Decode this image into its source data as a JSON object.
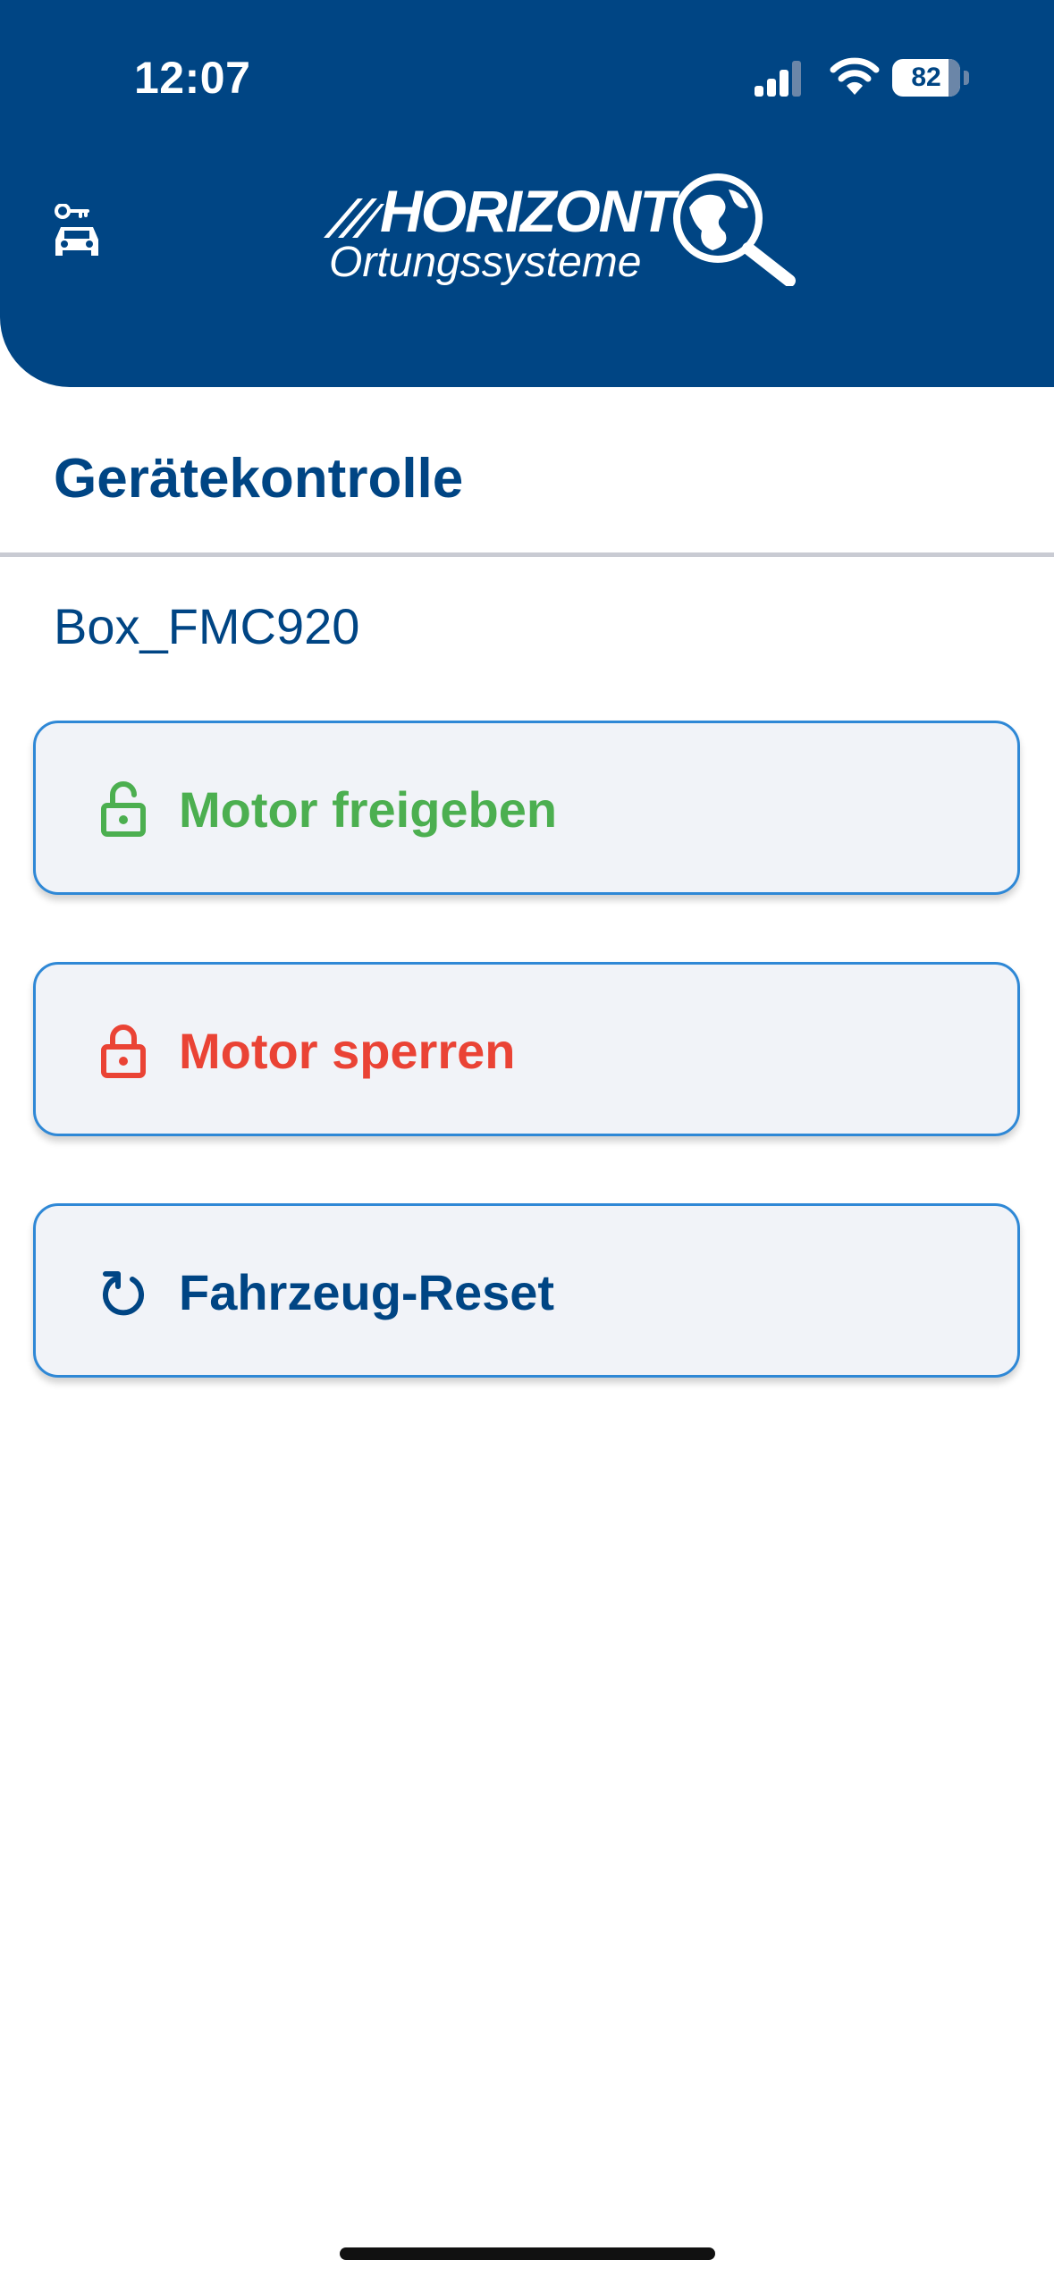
{
  "status_bar": {
    "time": "12:07",
    "battery": "82"
  },
  "header": {
    "logo_brand": "HORIZONT",
    "logo_sub": "Ortungssysteme",
    "left_icon": "car-key-icon"
  },
  "page": {
    "title": "Gerätekontrolle",
    "device_name": "Box_FMC920"
  },
  "actions": [
    {
      "label": "Motor freigeben",
      "icon": "unlock-icon",
      "color": "#4caf50"
    },
    {
      "label": "Motor sperren",
      "icon": "lock-icon",
      "color": "#ea4335"
    },
    {
      "label": "Fahrzeug-Reset",
      "icon": "reset-icon",
      "color": "#004584"
    }
  ],
  "colors": {
    "brand": "#004584",
    "button_border": "#2f88d6",
    "button_bg": "#f1f3f8",
    "divider": "#c9cbd3"
  }
}
